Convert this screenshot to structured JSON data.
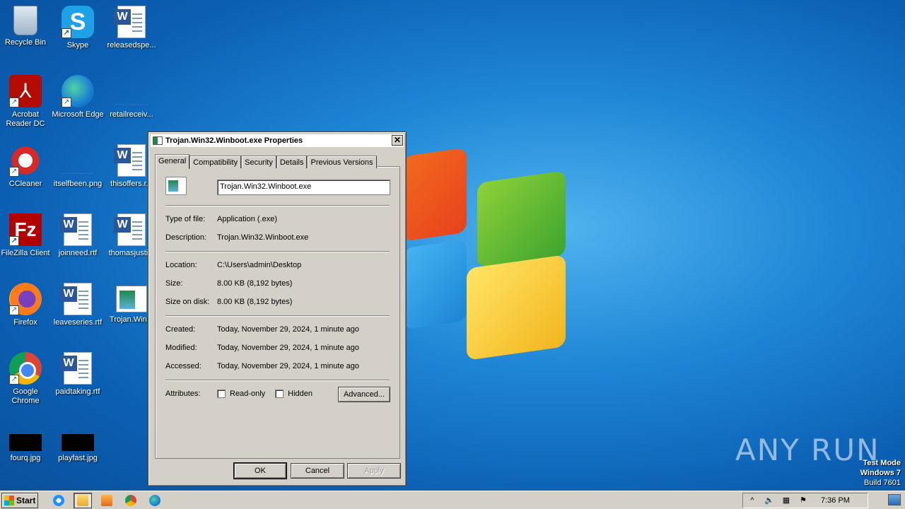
{
  "desktop_icons": [
    {
      "label": "Recycle Bin",
      "icon": "recycle-bin-icon"
    },
    {
      "label": "Skype",
      "icon": "skype-icon"
    },
    {
      "label": "releasedspe...",
      "icon": "word-document-icon"
    },
    {
      "label": "Acrobat Reader DC",
      "icon": "acrobat-icon"
    },
    {
      "label": "Microsoft Edge",
      "icon": "edge-icon"
    },
    {
      "label": "retailreceiv...",
      "icon": "file-icon"
    },
    {
      "label": "CCleaner",
      "icon": "ccleaner-icon"
    },
    {
      "label": "itselfbeen.png",
      "icon": "image-icon"
    },
    {
      "label": "thisoffers.r...",
      "icon": "word-document-icon"
    },
    {
      "label": "FileZilla Client",
      "icon": "filezilla-icon"
    },
    {
      "label": "joinneed.rtf",
      "icon": "word-document-icon"
    },
    {
      "label": "thomasjusti...",
      "icon": "word-document-icon"
    },
    {
      "label": "Firefox",
      "icon": "firefox-icon"
    },
    {
      "label": "leaveseries.rtf",
      "icon": "word-document-icon"
    },
    {
      "label": "Trojan.Win...",
      "icon": "exe-icon"
    },
    {
      "label": "Google Chrome",
      "icon": "chrome-icon"
    },
    {
      "label": "paidtaking.rtf",
      "icon": "word-document-icon"
    },
    {
      "label": "fourq.jpg",
      "icon": "image-icon"
    },
    {
      "label": "playfast.jpg",
      "icon": "image-icon"
    }
  ],
  "dialog": {
    "title": "Trojan.Win32.Winboot.exe Properties",
    "close_glyph": "✕",
    "tabs": [
      "General",
      "Compatibility",
      "Security",
      "Details",
      "Previous Versions"
    ],
    "file_name": "Trojan.Win32.Winboot.exe",
    "fields": {
      "type_label": "Type of file:",
      "type_value": "Application (.exe)",
      "desc_label": "Description:",
      "desc_value": "Trojan.Win32.Winboot.exe",
      "location_label": "Location:",
      "location_value": "C:\\Users\\admin\\Desktop",
      "size_label": "Size:",
      "size_value": "8.00 KB (8,192 bytes)",
      "sizeondisk_label": "Size on disk:",
      "sizeondisk_value": "8.00 KB (8,192 bytes)",
      "created_label": "Created:",
      "created_value": "Today, November 29, 2024, 1 minute ago",
      "modified_label": "Modified:",
      "modified_value": "Today, November 29, 2024, 1 minute ago",
      "accessed_label": "Accessed:",
      "accessed_value": "Today, November 29, 2024, 1 minute ago",
      "attributes_label": "Attributes:"
    },
    "readonly_label": "Read-only",
    "hidden_label": "Hidden",
    "advanced_label": "Advanced...",
    "ok_label": "OK",
    "cancel_label": "Cancel",
    "apply_label": "Apply"
  },
  "watermark": {
    "text": "ANY RUN"
  },
  "test_mode": {
    "line1": "Test Mode",
    "line2": "Windows 7",
    "line3": "Build 7601"
  },
  "taskbar": {
    "start_label": "Start",
    "clock": "7:36 PM",
    "tray_arrow": "^"
  }
}
